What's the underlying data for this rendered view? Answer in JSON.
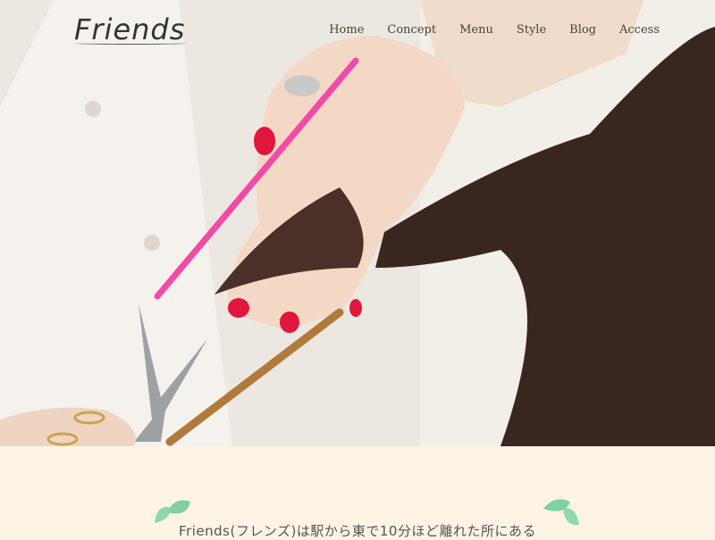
{
  "header": {
    "logo": "Friends",
    "nav": [
      "Home",
      "Concept",
      "Menu",
      "Style",
      "Blog",
      "Access"
    ]
  },
  "hero": {
    "image": "hair-cutting-photo"
  },
  "intro": {
    "text": "Friends(フレンズ)は駅から東で10分ほど離れた所にある"
  },
  "colors": {
    "background": "#fdf4e6",
    "leaf": "#7fd0a2",
    "nav_text": "#4a4035"
  }
}
